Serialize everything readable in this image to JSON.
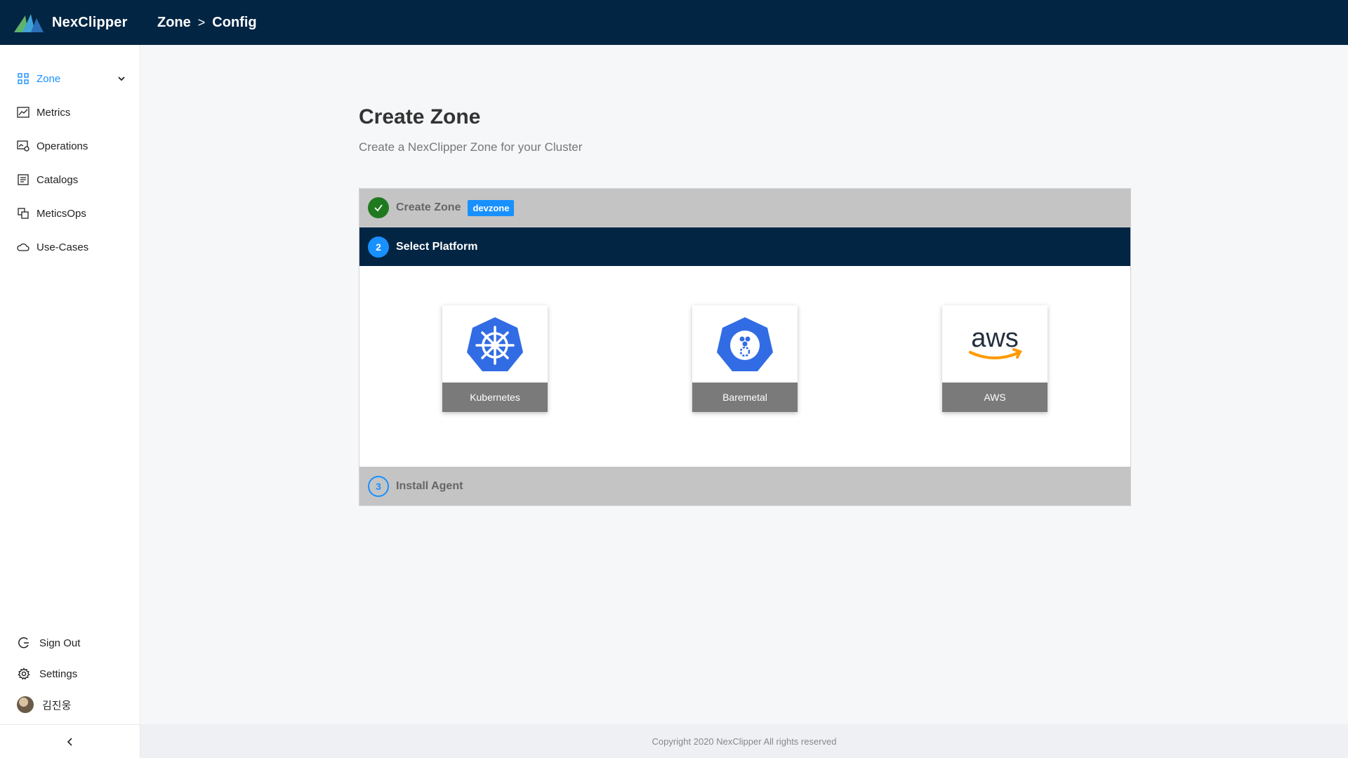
{
  "app": {
    "name": "NexClipper",
    "breadcrumb": [
      "Zone",
      "Config"
    ],
    "breadcrumb_separator": ">"
  },
  "sidebar": {
    "items": [
      {
        "label": "Zone",
        "icon": "grid-icon",
        "active": true,
        "expandable": true
      },
      {
        "label": "Metrics",
        "icon": "line-chart-icon"
      },
      {
        "label": "Operations",
        "icon": "monitor-settings-icon"
      },
      {
        "label": "Catalogs",
        "icon": "list-doc-icon"
      },
      {
        "label": "MeticsOps",
        "icon": "copy-icon"
      },
      {
        "label": "Use-Cases",
        "icon": "cloud-icon"
      }
    ],
    "bottom": {
      "sign_out": "Sign Out",
      "settings": "Settings",
      "user": "김진웅"
    }
  },
  "page": {
    "title": "Create Zone",
    "subtitle": "Create a NexClipper Zone for your Cluster"
  },
  "wizard": {
    "steps": [
      {
        "label": "Create Zone",
        "state": "done",
        "tag": "devzone"
      },
      {
        "label": "Select Platform",
        "state": "active",
        "number": "2"
      },
      {
        "label": "Install Agent",
        "state": "pending",
        "number": "3"
      }
    ],
    "platforms": [
      {
        "label": "Kubernetes",
        "icon": "kubernetes-icon"
      },
      {
        "label": "Baremetal",
        "icon": "baremetal-icon"
      },
      {
        "label": "AWS",
        "icon": "aws-icon"
      }
    ]
  },
  "footer": {
    "text": "Copyright 2020 NexClipper All rights reserved"
  },
  "colors": {
    "topbar": "#022544",
    "accent": "#1890ff",
    "step_done": "#c4c4c4",
    "check_green": "#1f7a1f",
    "k8s_blue": "#326ce5",
    "aws_orange": "#ff9900"
  }
}
